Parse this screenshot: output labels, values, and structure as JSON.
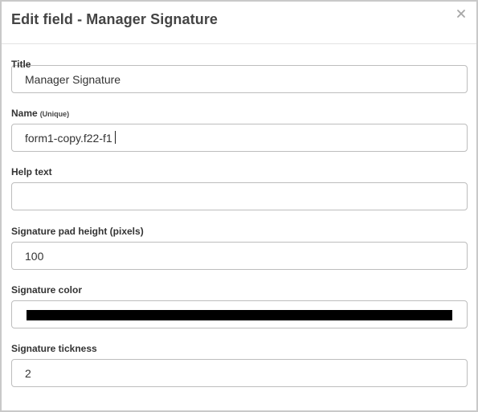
{
  "dialog": {
    "title": "Edit field - Manager Signature",
    "close_icon": "close-icon"
  },
  "fields": {
    "title": {
      "label": "Title",
      "value": "Manager Signature"
    },
    "name": {
      "label": "Name",
      "hint": "(Unique)",
      "value": "form1-copy.f22-f1"
    },
    "help_text": {
      "label": "Help text",
      "value": ""
    },
    "pad_height": {
      "label": "Signature pad height (pixels)",
      "value": "100"
    },
    "color": {
      "label": "Signature color",
      "value": "#000000"
    },
    "thickness": {
      "label": "Signature tickness",
      "value": "2"
    }
  }
}
